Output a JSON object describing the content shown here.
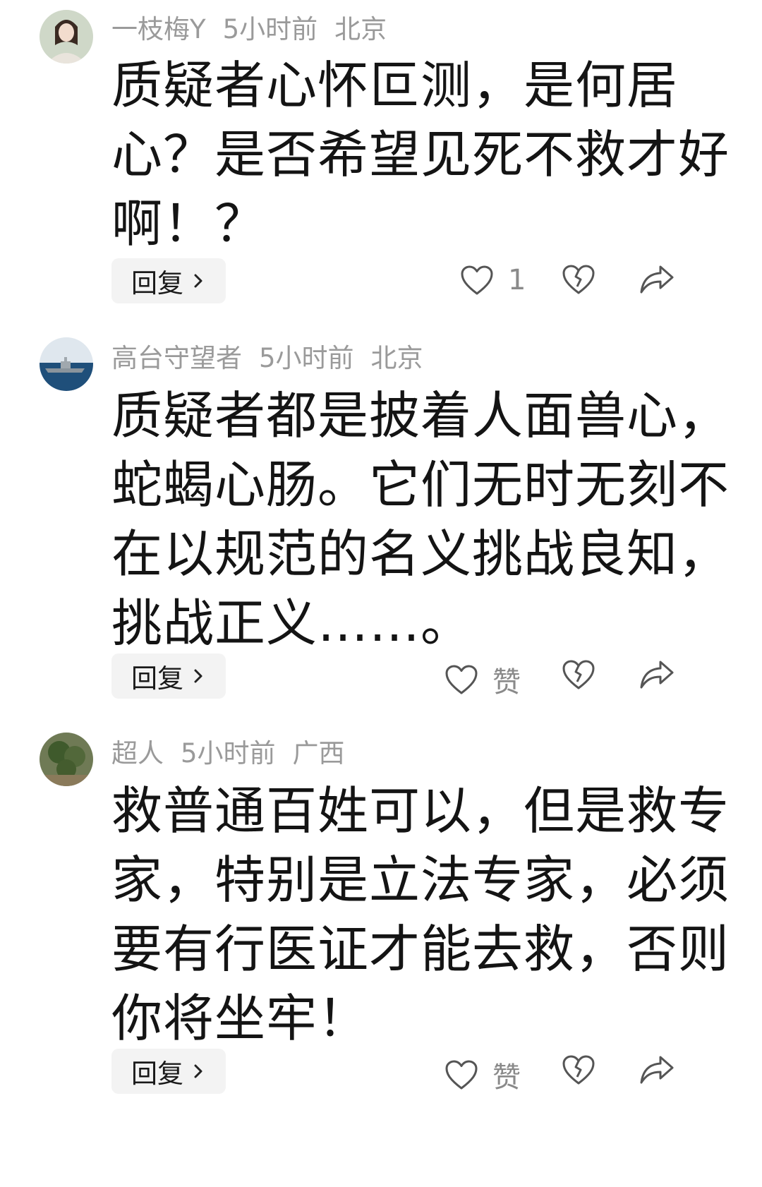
{
  "comments": [
    {
      "username": "一枝梅Y",
      "time": "5小时前",
      "location": "北京",
      "lines": [
        "质疑者心怀叵测，是何居",
        "心？是否希望见死不救才好",
        "啊！？"
      ],
      "reply_label": "回复",
      "like_label": "1"
    },
    {
      "username": "高台守望者",
      "time": "5小时前",
      "location": "北京",
      "lines": [
        "质疑者都是披着人面兽心，",
        "蛇蝎心肠。它们无时无刻不",
        "在以规范的名义挑战良知，",
        "挑战正义……。"
      ],
      "reply_label": "回复",
      "like_label": "赞"
    },
    {
      "username": "超人",
      "time": "5小时前",
      "location": "广西",
      "lines": [
        "救普通百姓可以，但是救专",
        "家，特别是立法专家，必须",
        "要有行医证才能去救，否则",
        "你将坐牢！"
      ],
      "reply_label": "回复",
      "like_label": "赞"
    }
  ],
  "icons": {
    "like": "heart-outline-icon",
    "dislike": "broken-heart-icon",
    "share": "share-arrow-icon",
    "chevron": "chevron-right-icon"
  },
  "colors": {
    "meta": "#9a9a9a",
    "text": "#141414",
    "reply_bg": "#f3f3f3",
    "icon_stroke": "#555555"
  }
}
